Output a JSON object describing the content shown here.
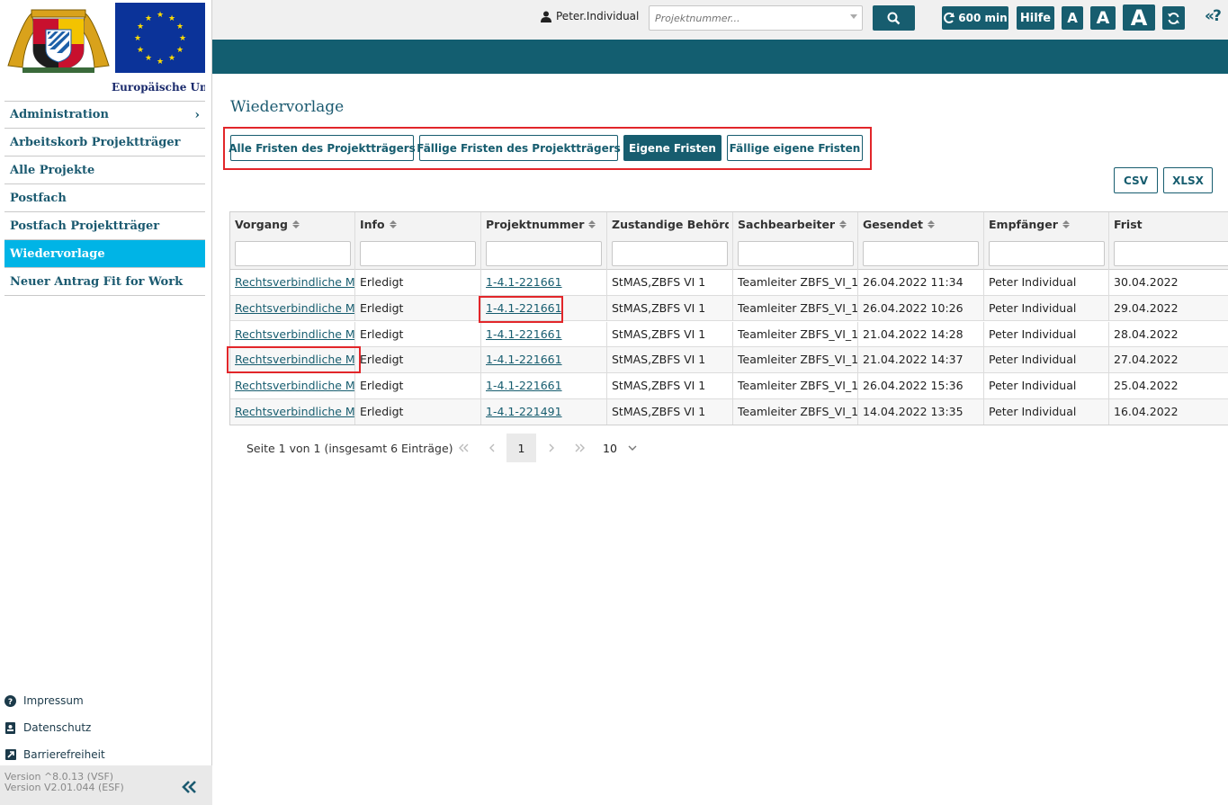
{
  "sidebar": {
    "logo_caption": "Europäische Uni",
    "nav": [
      {
        "label": "Administration"
      },
      {
        "label": "Arbeitskorb Projektträger"
      },
      {
        "label": "Alle Projekte"
      },
      {
        "label": "Postfach"
      },
      {
        "label": "Postfach Projektträger"
      },
      {
        "label": "Wiedervorlage",
        "active": true
      },
      {
        "label": "Neuer Antrag Fit for Work"
      }
    ],
    "footer": [
      {
        "label": "Impressum",
        "icon": "question-circle-icon"
      },
      {
        "label": "Datenschutz",
        "icon": "id-card-icon"
      },
      {
        "label": "Barrierefreiheit",
        "icon": "external-link-icon"
      }
    ],
    "versions": [
      "Version ^8.0.13 (VSF)",
      "Version V2.01.044 (ESF)"
    ],
    "collapse_label": "«"
  },
  "topbar": {
    "user": "Peter.Individual",
    "search_placeholder": "Projektnummer...",
    "timer": "600 min",
    "help": "Hilfe",
    "font_small": "A",
    "font_medium": "A",
    "font_large": "A",
    "hint": "«?"
  },
  "main": {
    "title": "Wiedervorlage",
    "filters": [
      {
        "label": "Alle Fristen des Projektträgers"
      },
      {
        "label": "Fällige Fristen des Projektträgers"
      },
      {
        "label": "Eigene Fristen",
        "active": true
      },
      {
        "label": "Fällige eigene Fristen"
      }
    ],
    "export": {
      "csv": "CSV",
      "xlsx": "XLSX"
    }
  },
  "table": {
    "columns": [
      "Vorgang",
      "Info",
      "Projektnummer",
      "Zustandige Behörde (",
      "Sachbearbeiter",
      "Gesendet",
      "Empfänger",
      "Frist"
    ],
    "sortable": [
      true,
      true,
      true,
      false,
      true,
      true,
      true,
      false
    ],
    "rows": [
      [
        "Rechtsverbindliche Mit",
        "Erledigt",
        "1-4.1-221661",
        "StMAS,ZBFS VI 1",
        "Teamleiter ZBFS_VI_1",
        "26.04.2022 11:34",
        "Peter Individual",
        "30.04.2022"
      ],
      [
        "Rechtsverbindliche Mit",
        "Erledigt",
        "1-4.1-221661",
        "StMAS,ZBFS VI 1",
        "Teamleiter ZBFS_VI_1",
        "26.04.2022 10:26",
        "Peter Individual",
        "29.04.2022"
      ],
      [
        "Rechtsverbindliche Mit",
        "Erledigt",
        "1-4.1-221661",
        "StMAS,ZBFS VI 1",
        "Teamleiter ZBFS_VI_1",
        "21.04.2022 14:28",
        "Peter Individual",
        "28.04.2022"
      ],
      [
        "Rechtsverbindliche Mit",
        "Erledigt",
        "1-4.1-221661",
        "StMAS,ZBFS VI 1",
        "Teamleiter ZBFS_VI_1",
        "21.04.2022 14:37",
        "Peter Individual",
        "27.04.2022"
      ],
      [
        "Rechtsverbindliche Mit",
        "Erledigt",
        "1-4.1-221661",
        "StMAS,ZBFS VI 1",
        "Teamleiter ZBFS_VI_1",
        "26.04.2022 15:36",
        "Peter Individual",
        "25.04.2022"
      ],
      [
        "Rechtsverbindliche Mit",
        "Erledigt",
        "1-4.1-221491",
        "StMAS,ZBFS VI 1",
        "Teamleiter ZBFS_VI_1",
        "14.04.2022 13:35",
        "Peter Individual",
        "16.04.2022"
      ]
    ]
  },
  "pager": {
    "summary": "Seite 1 von 1 (insgesamt 6 Einträge)",
    "current_page": "1",
    "page_size": "10",
    "first": "«",
    "prev": "‹",
    "next": "›",
    "last": "»"
  },
  "colors": {
    "primary": "#175d6f",
    "active_nav": "#00b4e6",
    "highlight": "#e2262a"
  }
}
